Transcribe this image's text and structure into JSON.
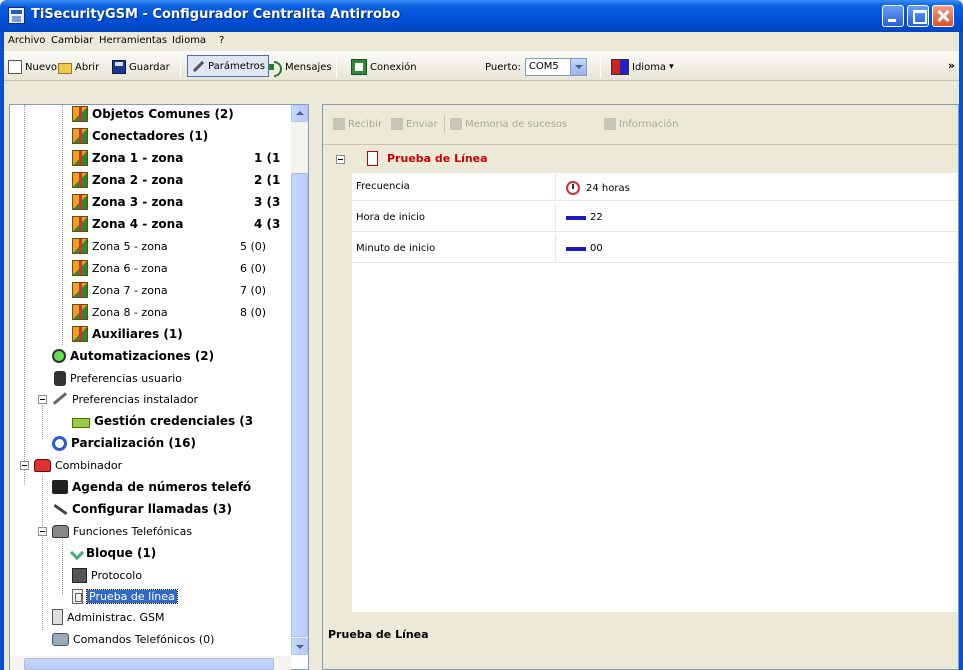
{
  "window": {
    "title": "TiSecurityGSM - Configurador Centralita Antirrobo"
  },
  "menu": [
    "Archivo",
    "Cambiar",
    "Herramientas",
    "Idioma",
    "?"
  ],
  "toolbar": {
    "nuevo": "Nuevo",
    "abrir": "Abrir",
    "guardar": "Guardar",
    "parametros": "Parámetros",
    "mensajes": "Mensajes",
    "conexion": "Conexión",
    "puerto_label": "Puerto:",
    "puerto_value": "COM5",
    "idioma": "Idioma",
    "more": "»"
  },
  "tree": {
    "items": [
      {
        "label": "Objetos Comunes (2)",
        "bold": true
      },
      {
        "label": "Conectadores (1)",
        "bold": true
      },
      {
        "label": "Zona 1 - zona",
        "count": "1 (1",
        "bold": true
      },
      {
        "label": "Zona 2 - zona",
        "count": "2 (1",
        "bold": true
      },
      {
        "label": "Zona 3 - zona",
        "count": "3 (3",
        "bold": true
      },
      {
        "label": "Zona 4 - zona",
        "count": "4 (3",
        "bold": true
      },
      {
        "label": "Zona 5 - zona",
        "count": "5 (0)",
        "bold": false
      },
      {
        "label": "Zona 6 - zona",
        "count": "6 (0)",
        "bold": false
      },
      {
        "label": "Zona 7 - zona",
        "count": "7 (0)",
        "bold": false
      },
      {
        "label": "Zona 8 - zona",
        "count": "8 (0)",
        "bold": false
      },
      {
        "label": "Auxiliares (1)",
        "bold": true
      },
      {
        "label": "Automatizaciones (2)",
        "bold": true
      },
      {
        "label": "Preferencias usuario",
        "bold": false
      },
      {
        "label": "Preferencias instalador",
        "bold": false
      },
      {
        "label": "Gestión credenciales (3",
        "bold": true
      },
      {
        "label": "Parcialización (16)",
        "bold": true
      },
      {
        "label": "Combinador",
        "bold": false
      },
      {
        "label": "Agenda de números telefó",
        "bold": true
      },
      {
        "label": "Configurar llamadas (3)",
        "bold": true
      },
      {
        "label": "Funciones Telefónicas",
        "bold": false
      },
      {
        "label": "Bloque (1)",
        "bold": true
      },
      {
        "label": "Protocolo",
        "bold": false
      },
      {
        "label": "Prueba de línea",
        "bold": false,
        "selected": true
      },
      {
        "label": "Administrac. GSM",
        "bold": false
      },
      {
        "label": "Comandos Telefónicos (0)",
        "bold": false
      }
    ]
  },
  "right_toolbar": {
    "recibir": "Recibir",
    "enviar": "Enviar",
    "memoria": "Memoria de sucesos",
    "informacion": "Información"
  },
  "property_grid": {
    "category": "Prueba de Línea",
    "rows": [
      {
        "name": "Frecuencia",
        "value": "24 horas",
        "icon": "clock-icon"
      },
      {
        "name": "Hora de inicio",
        "value": "22",
        "icon": "bar-icon"
      },
      {
        "name": "Minuto de inicio",
        "value": "00",
        "icon": "bar-icon"
      }
    ]
  },
  "description": {
    "title": "Prueba de Línea"
  }
}
